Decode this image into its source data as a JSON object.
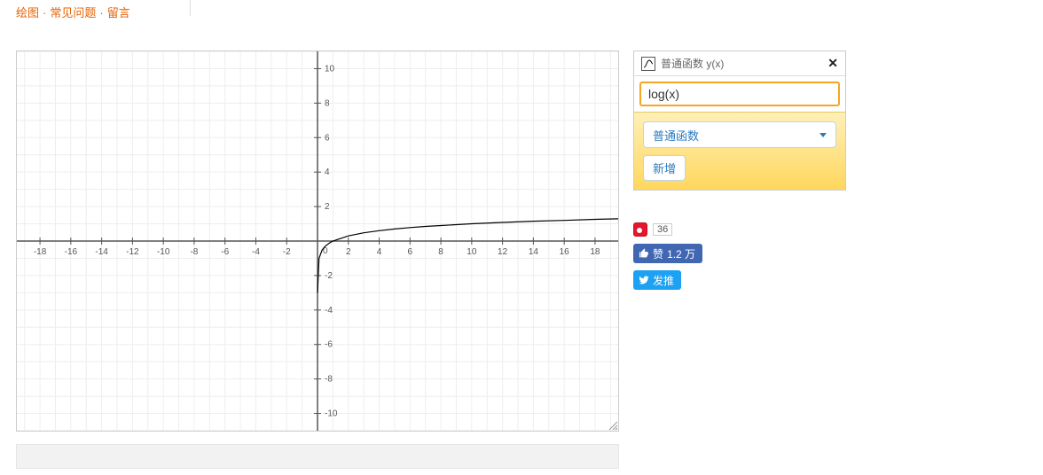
{
  "nav": {
    "l1": "绘图",
    "l2": "常见问题",
    "l3": "留言"
  },
  "function_panel": {
    "title": "普通函数 y(x)",
    "input_value": "log(x)",
    "select_label": "普通函数",
    "add_label": "新增"
  },
  "social": {
    "weibo_count": "36",
    "like_label": "赞",
    "like_count": "1.2 万",
    "tweet_label": "发推"
  },
  "chart_data": {
    "type": "line",
    "title": "",
    "xlabel": "",
    "ylabel": "",
    "xlim": [
      -19.5,
      19.5
    ],
    "ylim": [
      -11,
      11
    ],
    "x_ticks": [
      -18,
      -16,
      -14,
      -12,
      -10,
      -8,
      -6,
      -4,
      -2,
      0,
      2,
      4,
      6,
      8,
      10,
      12,
      14,
      16,
      18
    ],
    "y_ticks": [
      -10,
      -8,
      -6,
      -4,
      -2,
      0,
      2,
      4,
      6,
      8,
      10
    ],
    "series": [
      {
        "name": "log(x)",
        "x": [
          0.001,
          0.1,
          0.3,
          0.5,
          0.8,
          1,
          2,
          3,
          4,
          5,
          6,
          7,
          8,
          9,
          10,
          12,
          14,
          16,
          18,
          19.5
        ],
        "values": [
          -3.0,
          -1.0,
          -0.52,
          -0.3,
          -0.1,
          0,
          0.3,
          0.48,
          0.6,
          0.7,
          0.78,
          0.85,
          0.9,
          0.95,
          1.0,
          1.08,
          1.15,
          1.2,
          1.26,
          1.29
        ]
      }
    ]
  }
}
